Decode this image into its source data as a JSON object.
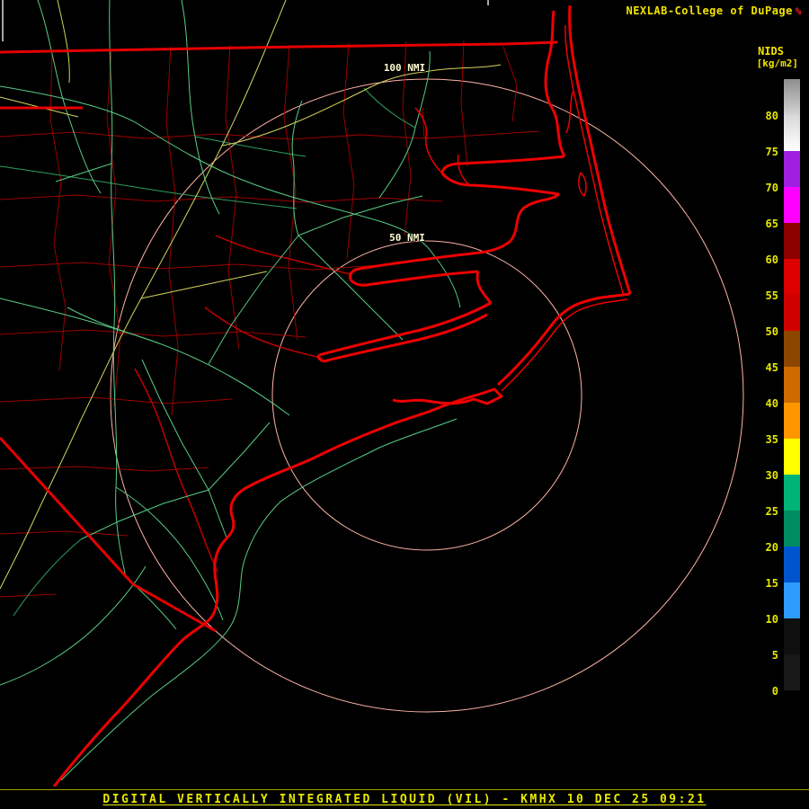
{
  "header": {
    "brand": "NEXLAB-College of DuPage",
    "logo_glyph": "%",
    "product_label": "NIDS",
    "units_label": "[kg/m2]"
  },
  "map": {
    "radar_site": "KMHX",
    "ring_labels": {
      "outer": "100 NMI",
      "inner": "50 NMI"
    }
  },
  "colorbar": {
    "units": "kg/m2",
    "segments": [
      {
        "label": "80",
        "color": "linear-gradient(#8e8e8e,#d4d4d4)"
      },
      {
        "label": "75",
        "color": "linear-gradient(#d8d8d8,#ffffff)"
      },
      {
        "label": "70",
        "color": "#a020e0"
      },
      {
        "label": "65",
        "color": "#ff00ff"
      },
      {
        "label": "60",
        "color": "#8c0000"
      },
      {
        "label": "55",
        "color": "#dc0000"
      },
      {
        "label": "50",
        "color": "#d00000"
      },
      {
        "label": "45",
        "color": "#8c4600"
      },
      {
        "label": "40",
        "color": "#cd6a00"
      },
      {
        "label": "35",
        "color": "#ff9600"
      },
      {
        "label": "30",
        "color": "#ffff00"
      },
      {
        "label": "25",
        "color": "#00b478"
      },
      {
        "label": "20",
        "color": "#008c5f"
      },
      {
        "label": "15",
        "color": "#0055cd"
      },
      {
        "label": "10",
        "color": "#2d9bff"
      },
      {
        "label": "5",
        "color": "#101010"
      },
      {
        "label": "0",
        "color": "#181818"
      }
    ]
  },
  "footer": {
    "caption": "DIGITAL VERTICALLY INTEGRATED LIQUID (VIL) - KMHX 10 DEC 25 09:21"
  },
  "colors": {
    "text_yellow": "#e8e800",
    "range_ring": "#ffb3a7",
    "coastline_red": "#ef0000",
    "county_red": "#9c0000",
    "road_green": "#58cc86",
    "road_dark_green": "#2f9f5f",
    "road_yellow": "#d4d45e",
    "background": "#000000"
  }
}
